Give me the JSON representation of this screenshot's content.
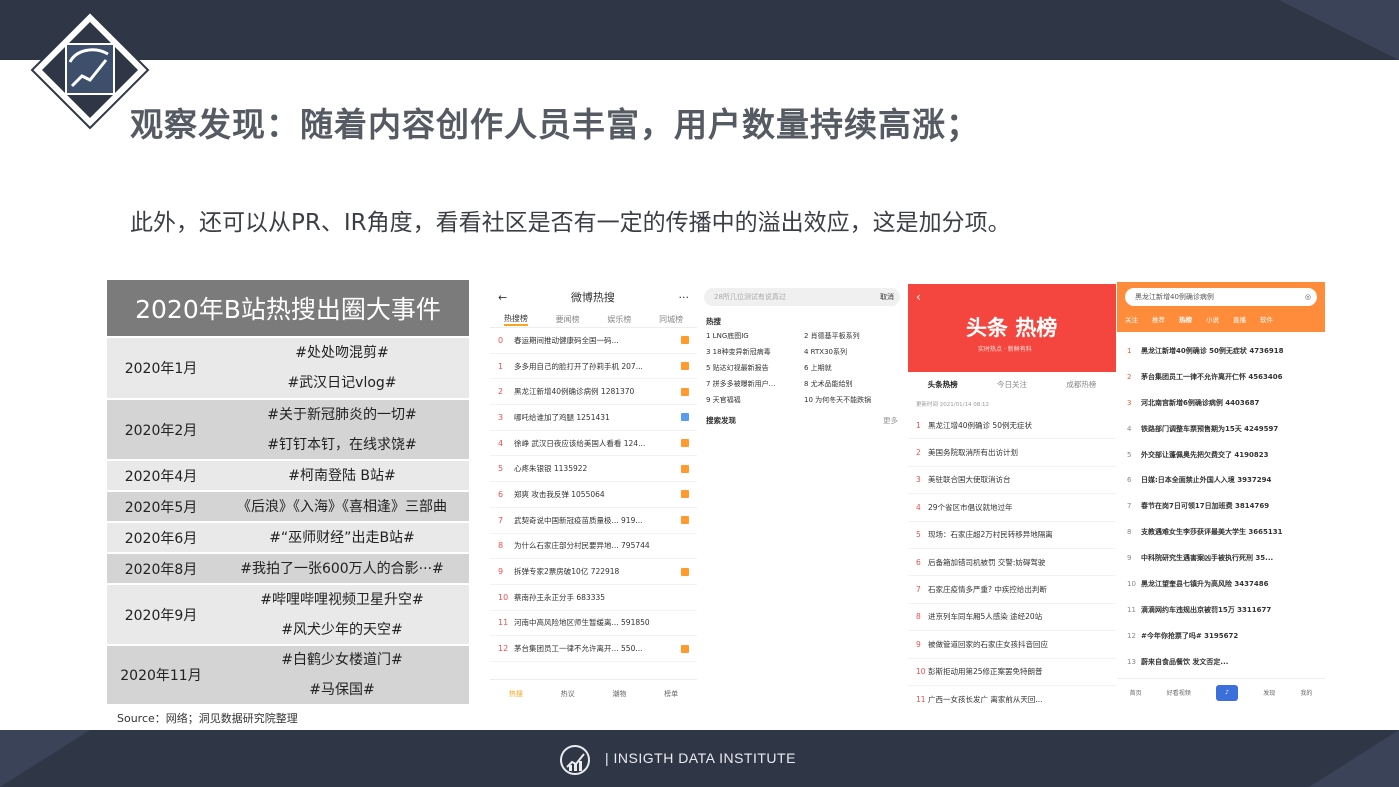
{
  "slide": {
    "title": "观察发现：随着内容创作人员丰富，用户数量持续高涨；",
    "subtitle": "此外，还可以从PR、IR角度，看看社区是否有一定的传播中的溢出效应，这是加分项。",
    "source": "Source：网络；洞见数据研究院整理",
    "footer_text": "|  INSIGTH   DATA   INSTITUTE"
  },
  "events_table": {
    "header": "2020年B站热搜出圈大事件",
    "rows": [
      {
        "date": "2020年1月",
        "items": [
          "#处处吻混剪#",
          "#武汉日记vlog#"
        ]
      },
      {
        "date": "2020年2月",
        "items": [
          "#关于新冠肺炎的一切#",
          "#钉钉本钉，在线求饶#"
        ]
      },
      {
        "date": "2020年4月",
        "items": [
          "#柯南登陆 B站#"
        ]
      },
      {
        "date": "2020年5月",
        "items": [
          "《后浪》《入海》《喜相逢》三部曲"
        ]
      },
      {
        "date": "2020年6月",
        "items": [
          "#“巫师财经”出走B站#"
        ]
      },
      {
        "date": "2020年8月",
        "items": [
          "#我拍了一张600万人的合影···#"
        ]
      },
      {
        "date": "2020年9月",
        "items": [
          "#哔哩哔哩视频卫星升空#",
          "#风犬少年的天空#"
        ]
      },
      {
        "date": "2020年11月",
        "items": [
          "#白鹤少女楼道门#",
          "#马保国#"
        ]
      }
    ]
  },
  "weibo": {
    "back": "←",
    "title": "微博热搜",
    "more": "···",
    "tabs": [
      "热搜榜",
      "要闻榜",
      "娱乐榜",
      "同城榜"
    ],
    "items": [
      {
        "rank": "0",
        "text": "春运期间推动健康码全国一码..."
      },
      {
        "rank": "1",
        "text": "多多用自己的脸打开了孙莉手机 207..."
      },
      {
        "rank": "2",
        "text": "黑龙江新增40例确诊病例 1281370"
      },
      {
        "rank": "3",
        "text": "哪吒给谁加了鸡腿 1251431"
      },
      {
        "rank": "4",
        "text": "徐峥 武汉日夜应该给美国人看看 124..."
      },
      {
        "rank": "5",
        "text": "心疼朱银银 1135922"
      },
      {
        "rank": "6",
        "text": "郑爽 攻击我反弹 1055064"
      },
      {
        "rank": "7",
        "text": "武契奇说中国新冠疫苗质量极... 919..."
      },
      {
        "rank": "8",
        "text": "为什么石家庄部分村民要异地... 795744"
      },
      {
        "rank": "9",
        "text": "拆弹专家2票房破10亿 722918"
      },
      {
        "rank": "10",
        "text": "蔡南孙王永正分手 683335"
      },
      {
        "rank": "11",
        "text": "河南中高风险地区师生暂缓离... 591850"
      },
      {
        "rank": "12",
        "text": "茅台集团员工一律不允许离开... 550..."
      }
    ],
    "footer": [
      "热搜",
      "热议",
      "潮物",
      "榜单"
    ]
  },
  "search_panel": {
    "placeholder": "28所几位测试有说真过",
    "cancel": "取消",
    "hot_label": "热搜",
    "hot_items": [
      "1  LNG底图IG",
      "2  肖德基平板系列",
      "3  18种变异新冠病毒",
      "4  RTX30系列",
      "5  贴达幻视最新报告",
      "6  上期就",
      "7  拼多多被曝新用户...",
      "8  尤术品能给别",
      "9  天官福福",
      "10  为何冬天不能跌锅"
    ],
    "discover_label": "搜索发现",
    "more": "更多"
  },
  "toutiao": {
    "logo": "头条 热榜",
    "tagline": "实时热点 · 新鲜有料",
    "tabs": [
      "头条热榜",
      "今日关注",
      "成都热榜"
    ],
    "updated": "更新时间 2021/01/14 08:12",
    "items": [
      {
        "rank": "1",
        "text": "黑龙江增40例确诊 50例无症状"
      },
      {
        "rank": "2",
        "text": "美国务院取消所有出访计划"
      },
      {
        "rank": "3",
        "text": "美驻联合国大使取消访台"
      },
      {
        "rank": "4",
        "text": "29个省区市倡议就地过年"
      },
      {
        "rank": "5",
        "text": "现场：石家庄超2万村民转移异地隔离"
      },
      {
        "rank": "6",
        "text": "后备箱加错司机被罚 交警:妨碍驾驶"
      },
      {
        "rank": "7",
        "text": "石家庄疫情多严重? 中疾控给出判断"
      },
      {
        "rank": "8",
        "text": "进京列车同车厢5人感染 途经20站"
      },
      {
        "rank": "9",
        "text": "被做管道回家的石家庄女孩抖音回应"
      },
      {
        "rank": "10",
        "text": "彭斯拒动用第25修正案罢免特朗普"
      },
      {
        "rank": "11",
        "text": "广西一女孩长发广 离家前从天回..."
      }
    ]
  },
  "baidu": {
    "search": "黑龙江新增40例确诊病例",
    "tabs": [
      "关注",
      "推荐",
      "热榜",
      "小说",
      "直播",
      "软件"
    ],
    "items": [
      {
        "rank": "1",
        "text": "黑龙江新增40例确诊 50例无症状 4736918"
      },
      {
        "rank": "2",
        "text": "茅台集团员工一律不允许离开仁怀 4563406"
      },
      {
        "rank": "3",
        "text": "河北南宫新增6例确诊病例 4403687"
      },
      {
        "rank": "4",
        "text": "铁路部门调整车票预售期为15天 4249597"
      },
      {
        "rank": "5",
        "text": "外交部让蓬佩奥先把欠费交了 4190823"
      },
      {
        "rank": "6",
        "text": "日媒:日本全面禁止外国人入境 3937294"
      },
      {
        "rank": "7",
        "text": "春节在岗7日可领17日加班费 3814769"
      },
      {
        "rank": "8",
        "text": "支教遇难女生李莎获评最美大学生 3665131"
      },
      {
        "rank": "9",
        "text": "中科院研究生遇害案凶手被执行死刑 35..."
      },
      {
        "rank": "10",
        "text": "黑龙江望奎县七镇升为高风险 3437486"
      },
      {
        "rank": "11",
        "text": "滴滴网约车违规出京被罚15万 3311677"
      },
      {
        "rank": "12",
        "text": "#今年你抢票了吗# 3195672"
      },
      {
        "rank": "13",
        "text": "蔚来自食品餐饮 发文否定..."
      }
    ],
    "footer": [
      "首页",
      "好看视频",
      "",
      "发现",
      "我的"
    ]
  },
  "colors": {
    "band": "#2f3747",
    "table_header": "#7b7b7b",
    "row_light": "#e9e9e9",
    "row_dark": "#d4d4d4",
    "toutiao_red": "#f4463e",
    "baidu_orange": "#ff8c3a"
  }
}
